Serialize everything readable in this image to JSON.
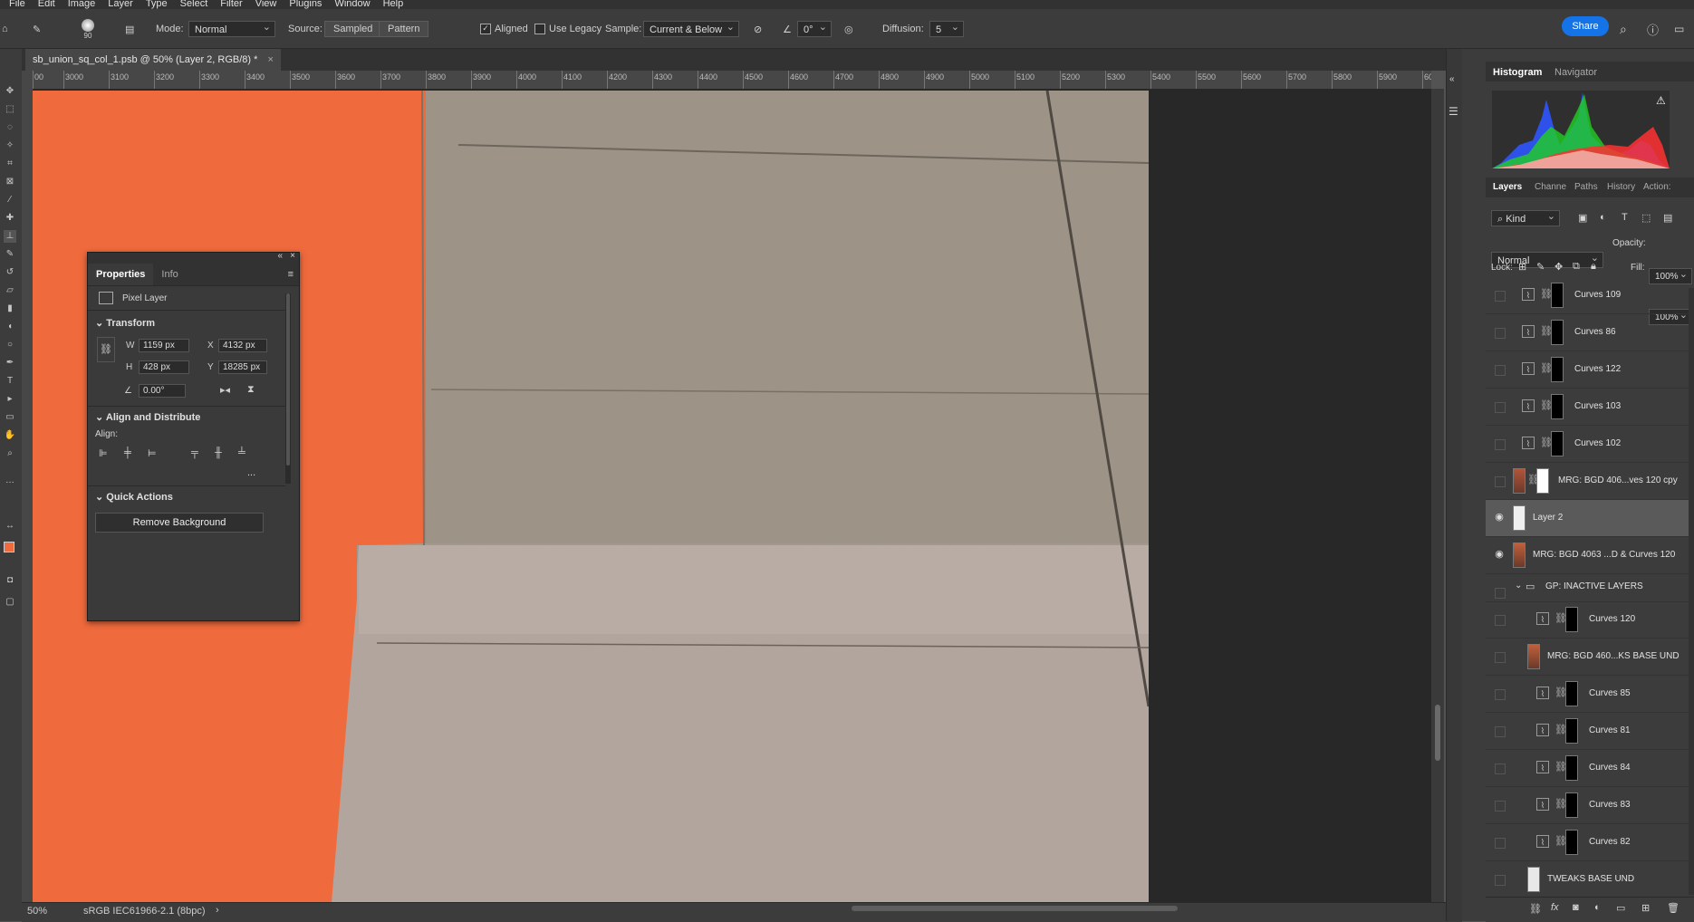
{
  "menu": [
    "File",
    "Edit",
    "Image",
    "Layer",
    "Type",
    "Select",
    "Filter",
    "View",
    "Plugins",
    "Window",
    "Help"
  ],
  "options": {
    "brush_size": "90",
    "mode_label": "Mode:",
    "mode_value": "Normal",
    "source_label": "Source:",
    "source_sampled": "Sampled",
    "source_pattern": "Pattern",
    "aligned_label": "Aligned",
    "legacy_label": "Use Legacy",
    "sample_label": "Sample:",
    "sample_value": "Current & Below",
    "angle_value": "0°",
    "diffusion_label": "Diffusion:",
    "diffusion_value": "5",
    "share_label": "Share"
  },
  "document": {
    "tab_title": "sb_union_sq_col_1.psb @ 50% (Layer 2, RGB/8) *",
    "zoom": "50%",
    "color_profile": "sRGB IEC61966-2.1 (8bpc)",
    "ruler_ticks": [
      "00",
      "3000",
      "3100",
      "3200",
      "3300",
      "3400",
      "3500",
      "3600",
      "3700",
      "3800",
      "3900",
      "4000",
      "4100",
      "4200",
      "4300",
      "4400",
      "4500",
      "4600",
      "4700",
      "4800",
      "4900",
      "5000",
      "5100",
      "5200",
      "5300",
      "5400",
      "5500",
      "5600",
      "5700",
      "5800",
      "5900",
      "60"
    ]
  },
  "properties": {
    "tabs": [
      "Properties",
      "Info"
    ],
    "layer_type": "Pixel Layer",
    "transform_title": "Transform",
    "w_label": "W",
    "w_value": "1159 px",
    "x_label": "X",
    "x_value": "4132 px",
    "h_label": "H",
    "h_value": "428 px",
    "y_label": "Y",
    "y_value": "18285 px",
    "angle_value": "0.00°",
    "align_title": "Align and Distribute",
    "align_label": "Align:",
    "more": "...",
    "quick_title": "Quick Actions",
    "remove_bg": "Remove Background"
  },
  "right_panel": {
    "top_tabs": [
      "Histogram",
      "Navigator"
    ],
    "layer_tabs": [
      "Layers",
      "Channe",
      "Paths",
      "History",
      "Action:"
    ],
    "kind_value": "Kind",
    "blend_value": "Normal",
    "opacity_label": "Opacity:",
    "opacity_value": "100%",
    "lock_label": "Lock:",
    "fill_label": "Fill:",
    "fill_value": "100%",
    "layers": [
      {
        "name": "Curves 109",
        "kind": "curves",
        "visible": false,
        "indent": 0,
        "selected": false
      },
      {
        "name": "Curves 86",
        "kind": "curves",
        "visible": false,
        "indent": 0,
        "selected": false
      },
      {
        "name": "Curves 122",
        "kind": "curves",
        "visible": false,
        "indent": 0,
        "selected": false
      },
      {
        "name": "Curves 103",
        "kind": "curves",
        "visible": false,
        "indent": 0,
        "selected": false
      },
      {
        "name": "Curves 102",
        "kind": "curves",
        "visible": false,
        "indent": 0,
        "selected": false
      },
      {
        "name": "MRG: BGD 406...ves 120 cpy",
        "kind": "pixel-mask",
        "visible": false,
        "indent": 0,
        "selected": false
      },
      {
        "name": "Layer 2",
        "kind": "pixel",
        "visible": true,
        "indent": 0,
        "selected": true
      },
      {
        "name": "MRG: BGD 4063 ...D & Curves 120",
        "kind": "pixel",
        "visible": true,
        "indent": 0,
        "selected": false
      },
      {
        "name": "GP:  INACTIVE LAYERS",
        "kind": "group",
        "visible": false,
        "indent": 0,
        "selected": false
      },
      {
        "name": "Curves 120",
        "kind": "curves",
        "visible": false,
        "indent": 1,
        "selected": false
      },
      {
        "name": "MRG: BGD 460...KS BASE UND",
        "kind": "pixel",
        "visible": false,
        "indent": 1,
        "selected": false
      },
      {
        "name": "Curves 85",
        "kind": "curves",
        "visible": false,
        "indent": 1,
        "selected": false
      },
      {
        "name": "Curves 81",
        "kind": "curves",
        "visible": false,
        "indent": 1,
        "selected": false
      },
      {
        "name": "Curves 84",
        "kind": "curves",
        "visible": false,
        "indent": 1,
        "selected": false
      },
      {
        "name": "Curves 83",
        "kind": "curves",
        "visible": false,
        "indent": 1,
        "selected": false
      },
      {
        "name": "Curves 82",
        "kind": "curves",
        "visible": false,
        "indent": 1,
        "selected": false
      },
      {
        "name": "TWEAKS BASE UND",
        "kind": "pixel",
        "visible": false,
        "indent": 1,
        "selected": false
      }
    ]
  },
  "colors": {
    "accent": "#1473e6",
    "orange": "#ef6a3d",
    "stone": "#a69d92"
  }
}
